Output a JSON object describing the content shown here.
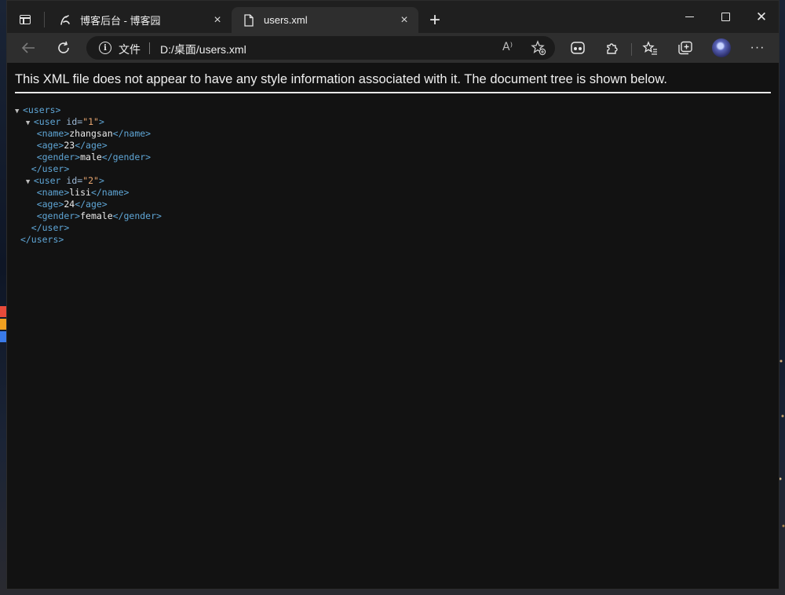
{
  "browser": {
    "tabs": [
      {
        "title": "博客后台 - 博客园",
        "active": false
      },
      {
        "title": "users.xml",
        "active": true
      }
    ],
    "address": {
      "scheme_label": "文件",
      "url": "D:/桌面/users.xml",
      "read_aloud_icon": "A⁾"
    },
    "icons": {
      "tab_actions": "tab-actions-icon",
      "back": "back-arrow-icon",
      "reload": "reload-icon",
      "info": "i",
      "favorites_add": "star-plus-icon",
      "collections": "game-controller-icon",
      "extensions": "puzzle-icon",
      "favorites": "star-list-icon",
      "collections2": "collections-icon",
      "more": "···",
      "close": "×",
      "new_tab": "+",
      "window_close": "✕"
    }
  },
  "page": {
    "notice": "This XML file does not appear to have any style information associated with it. The document tree is shown below.",
    "xml": {
      "root_open": "<users>",
      "root_close": "</users>",
      "users": [
        {
          "open_prefix": "<user ",
          "attr_name": "id=",
          "attr_value": "\"1\"",
          "open_suffix": ">",
          "fields": [
            {
              "open": "<name>",
              "value": "zhangsan",
              "close": "</name>"
            },
            {
              "open": "<age>",
              "value": "23",
              "close": "</age>"
            },
            {
              "open": "<gender>",
              "value": "male",
              "close": "</gender>"
            }
          ],
          "close": "</user>"
        },
        {
          "open_prefix": "<user ",
          "attr_name": "id=",
          "attr_value": "\"2\"",
          "open_suffix": ">",
          "fields": [
            {
              "open": "<name>",
              "value": "lisi",
              "close": "</name>"
            },
            {
              "open": "<age>",
              "value": "24",
              "close": "</age>"
            },
            {
              "open": "<gender>",
              "value": "female",
              "close": "</gender>"
            }
          ],
          "close": "</user>"
        }
      ]
    }
  },
  "colors": {
    "tag": "#5fa6d6",
    "attr_value": "#e9a670",
    "background": "#121212"
  }
}
